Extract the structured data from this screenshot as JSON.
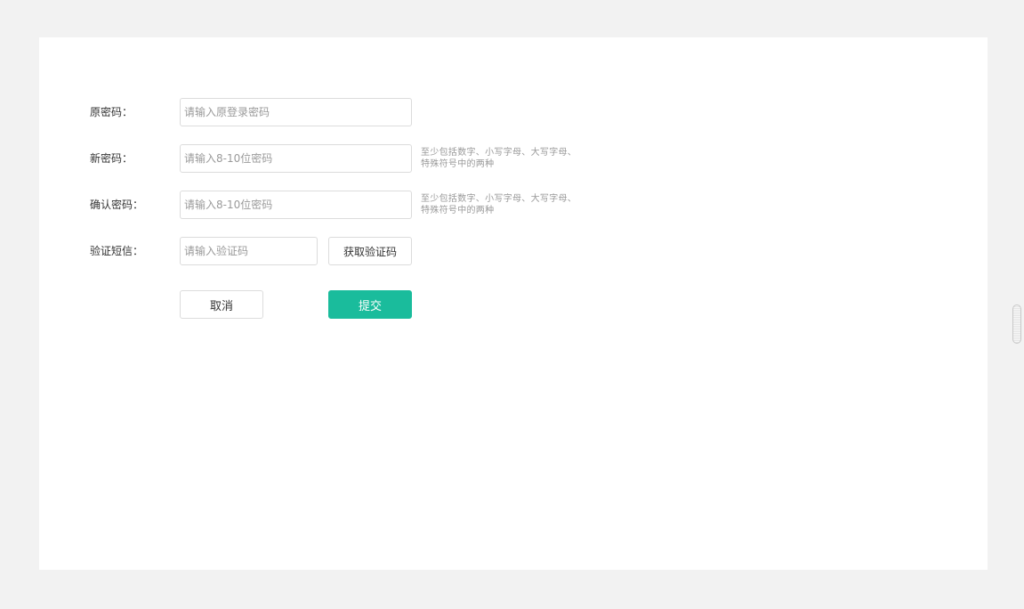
{
  "form": {
    "old_password": {
      "label": "原密码：",
      "value": "",
      "placeholder": "请输入原登录密码"
    },
    "new_password": {
      "label": "新密码：",
      "value": "",
      "placeholder": "请输入8-10位密码",
      "hint": "至少包括数字、小写字母、大写字母、特殊符号中的两种"
    },
    "confirm_password": {
      "label": "确认密码：",
      "value": "",
      "placeholder": "请输入8-10位密码",
      "hint": "至少包括数字、小写字母、大写字母、特殊符号中的两种"
    },
    "sms_code": {
      "label": "验证短信：",
      "value": "",
      "placeholder": "请输入验证码",
      "button_label": "获取验证码"
    },
    "actions": {
      "cancel_label": "取消",
      "submit_label": "提交"
    }
  },
  "colors": {
    "page_background": "#f2f2f2",
    "panel_background": "#ffffff",
    "accent": "#1abc9c",
    "border": "#dcdcdc",
    "hint_text": "#999999"
  }
}
